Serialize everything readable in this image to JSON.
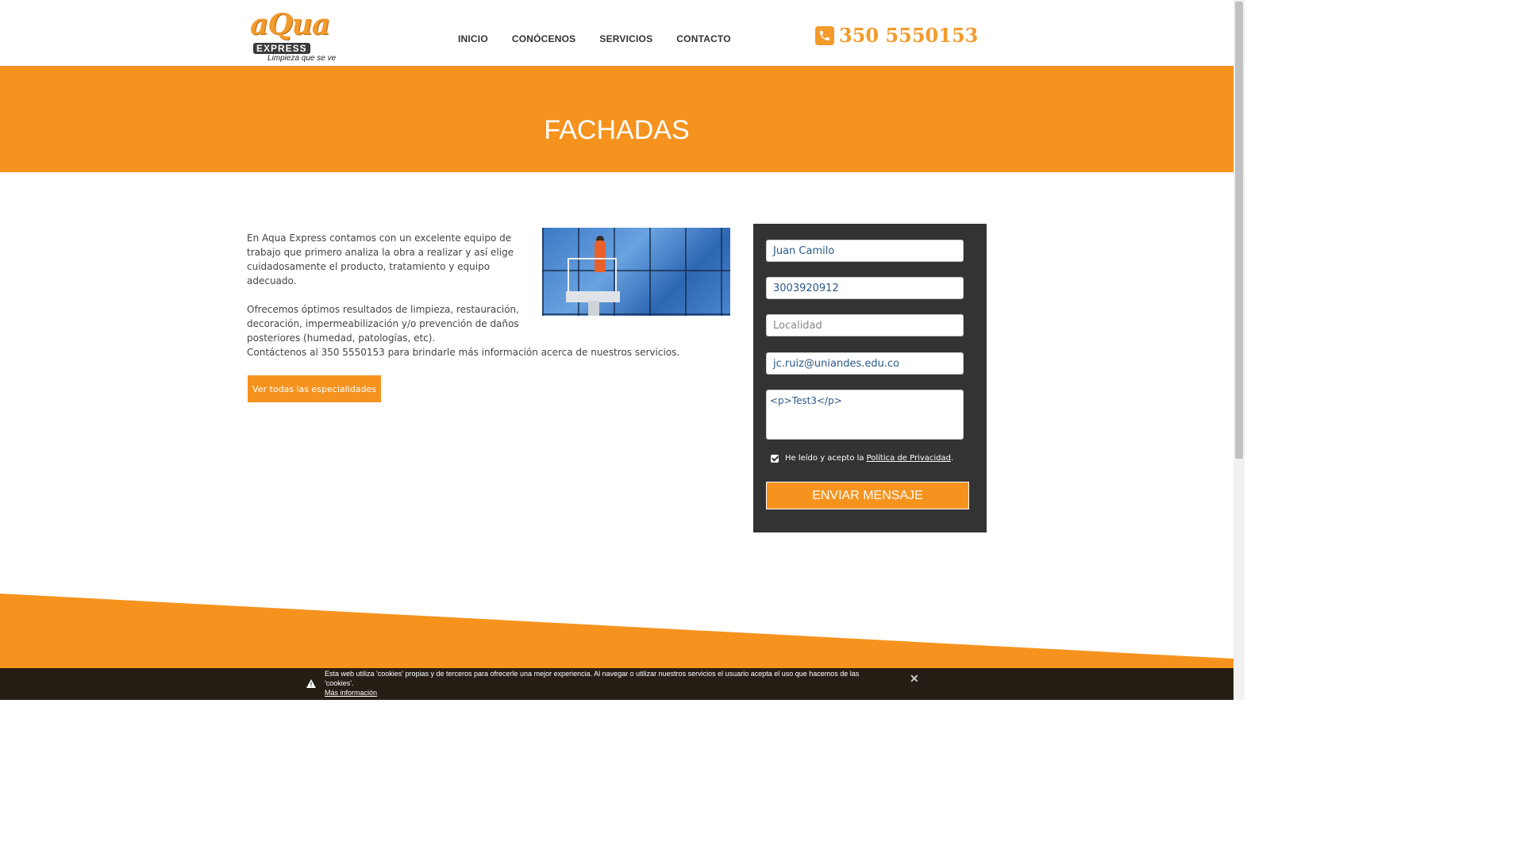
{
  "header": {
    "logo_main": "aQua",
    "logo_express": "EXPRESS",
    "logo_tagline": "Limpieza que se ve",
    "nav": [
      "INICIO",
      "CONÓCENOS",
      "SERVICIOS",
      "CONTACTO"
    ],
    "phone": "350 5550153",
    "phone_icon": "phone-icon"
  },
  "banner": {
    "title": "FACHADAS"
  },
  "content": {
    "paragraph1": "En Aqua Express contamos con un excelente equipo de trabajo que primero analiza la obra a realizar y así elige cuidadosamente el producto, tratamiento y equipo adecuado.",
    "paragraph2": "Ofrecemos óptimos resultados de limpieza, restauración, decoración, impermeabilización y/o prevención de daños posteriores (humedad, patologías, etc).",
    "contact_line": "Contáctenos al 350 5550153 para brindarle más información acerca de nuestros servicios.",
    "button": "Ver todas las especialidades"
  },
  "form": {
    "name_value": "Juan Camilo",
    "phone_value": "3003920912",
    "locality_placeholder": "Localidad",
    "email_value": "jc.ruiz@uniandes.edu.co",
    "message_value": "<p>Test3</p>",
    "privacy_text": "He leído y acepto la",
    "privacy_link": "Política de Privacidad",
    "privacy_checked": true,
    "submit": "ENVIAR MENSAJE"
  },
  "cookie_bar": {
    "text": "Esta web utiliza 'cookies' propias y de terceros para ofrecerle una mejor experiencia. Al navegar o utilizar nuestros servicios el usuario acepta el uso que hacemos de las 'cookies'.",
    "more": "Más información",
    "close": "✕"
  },
  "colors": {
    "accent": "#f6931f",
    "panel": "#333333"
  }
}
